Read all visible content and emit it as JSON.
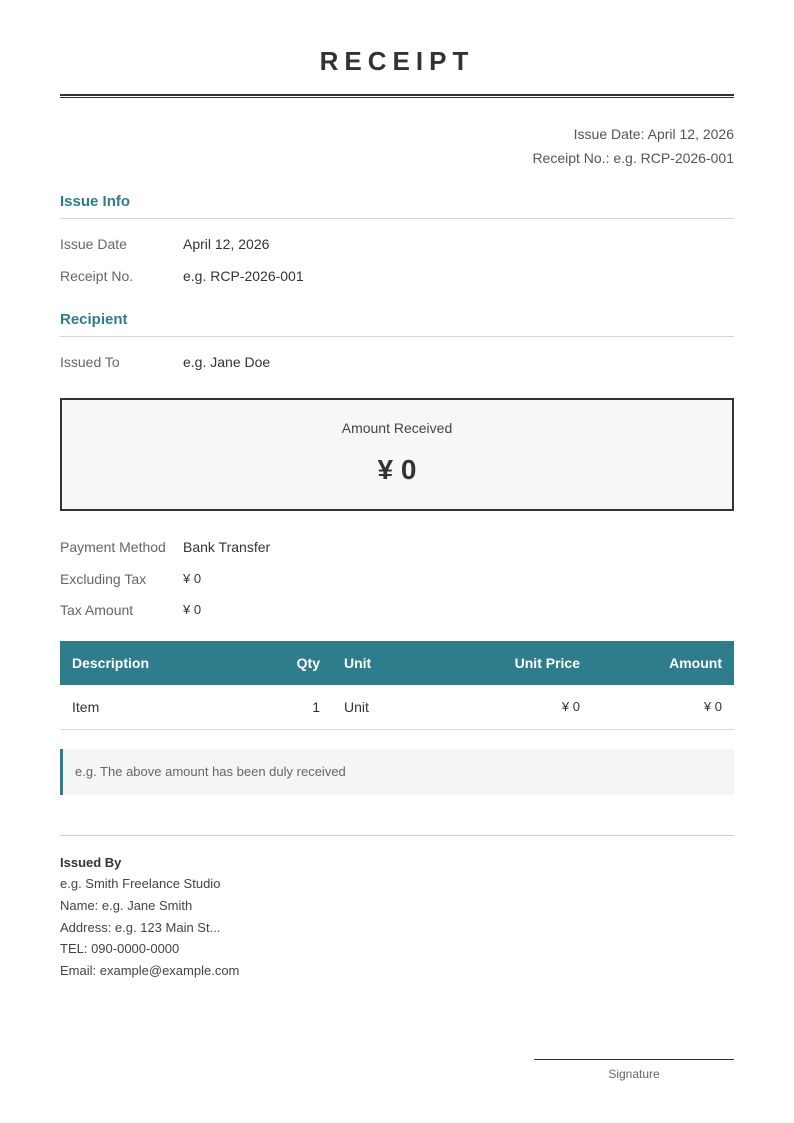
{
  "title": "RECEIPT",
  "meta": {
    "issue_date": "Issue Date: April 12, 2026",
    "receipt_no": "Receipt No.: e.g. RCP-2026-001"
  },
  "issue_info": {
    "heading": "Issue Info",
    "issue_date_label": "Issue Date",
    "issue_date_value": "April 12, 2026",
    "receipt_no_label": "Receipt No.",
    "receipt_no_value": "e.g. RCP-2026-001"
  },
  "recipient": {
    "heading": "Recipient",
    "issued_to_label": "Issued To",
    "issued_to_value": "e.g. Jane Doe"
  },
  "amount": {
    "label": "Amount Received",
    "value": "¥ 0"
  },
  "payment": {
    "method_label": "Payment Method",
    "method_value": "Bank Transfer",
    "excl_tax_label": "Excluding Tax",
    "excl_tax_value": "¥ 0",
    "tax_label": "Tax Amount",
    "tax_value": "¥ 0"
  },
  "table": {
    "headers": {
      "description": "Description",
      "qty": "Qty",
      "unit": "Unit",
      "unit_price": "Unit Price",
      "amount": "Amount"
    },
    "rows": [
      {
        "description": "Item",
        "qty": "1",
        "unit": "Unit",
        "unit_price": "¥ 0",
        "amount": "¥ 0"
      }
    ]
  },
  "note": "e.g. The above amount has been duly received",
  "issuer": {
    "heading": "Issued By",
    "business": "e.g. Smith Freelance Studio",
    "name": "Name: e.g. Jane Smith",
    "address": "Address: e.g. 123 Main St...",
    "tel": "TEL: 090-0000-0000",
    "email": "Email: example@example.com"
  },
  "signature_label": "Signature",
  "colors": {
    "accent": "#2e7d8c",
    "text": "#333333"
  }
}
